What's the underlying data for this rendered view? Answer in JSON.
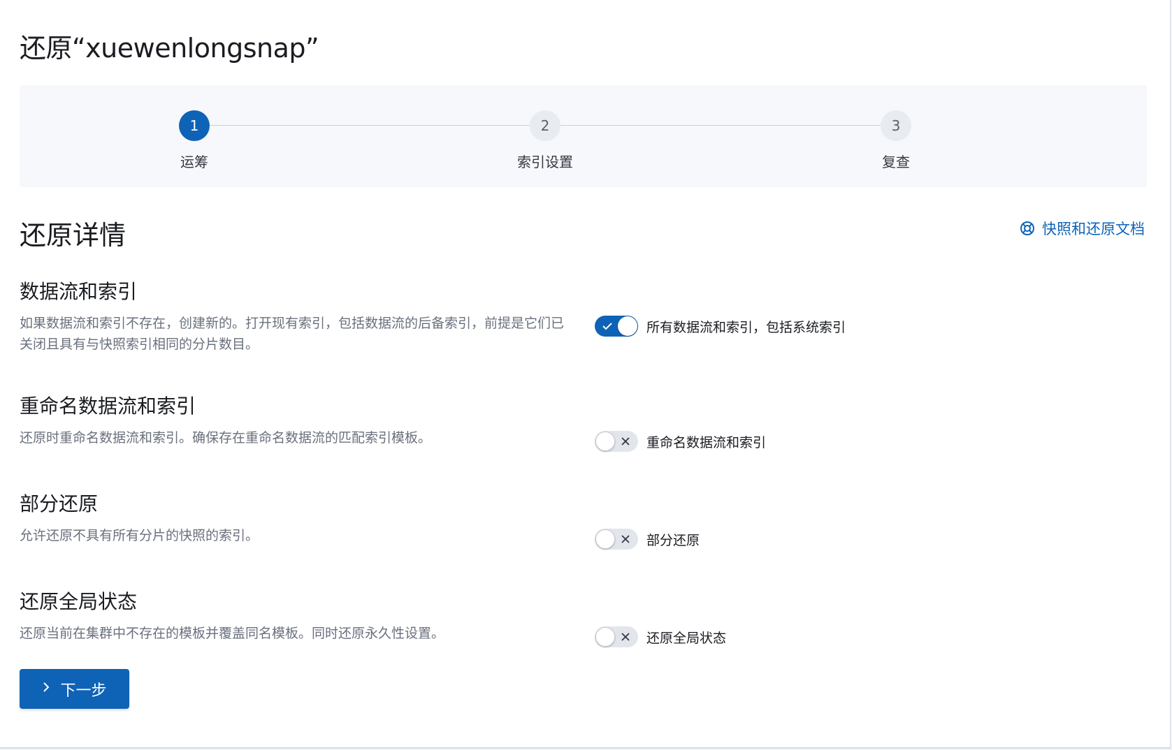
{
  "page": {
    "title": "还原“xuewenlongsnap”"
  },
  "steps": [
    {
      "number": "1",
      "label": "运筹",
      "state": "active"
    },
    {
      "number": "2",
      "label": "索引设置",
      "state": "inactive"
    },
    {
      "number": "3",
      "label": "复查",
      "state": "inactive"
    }
  ],
  "details": {
    "title": "还原详情",
    "docs_link": "快照和还原文档",
    "docs_icon": "help-lifebuoy-icon"
  },
  "sections": [
    {
      "title": "数据流和索引",
      "description": "如果数据流和索引不存在，创建新的。打开现有索引，包括数据流的后备索引，前提是它们已关闭且具有与快照索引相同的分片数目。",
      "toggle_label": "所有数据流和索引，包括系统索引",
      "toggle_on": true
    },
    {
      "title": "重命名数据流和索引",
      "description": "还原时重命名数据流和索引。确保存在重命名数据流的匹配索引模板。",
      "toggle_label": "重命名数据流和索引",
      "toggle_on": false
    },
    {
      "title": "部分还原",
      "description": "允许还原不具有所有分片的快照的索引。",
      "toggle_label": "部分还原",
      "toggle_on": false
    },
    {
      "title": "还原全局状态",
      "description": "还原当前在集群中不存在的模板并覆盖同名模板。同时还原永久性设置。",
      "toggle_label": "还原全局状态",
      "toggle_on": false
    }
  ],
  "actions": {
    "next_label": "下一步"
  },
  "colors": {
    "primary": "#0e63b6",
    "step_inactive_bg": "#e8ebf0",
    "subdued_text": "#69707d"
  }
}
